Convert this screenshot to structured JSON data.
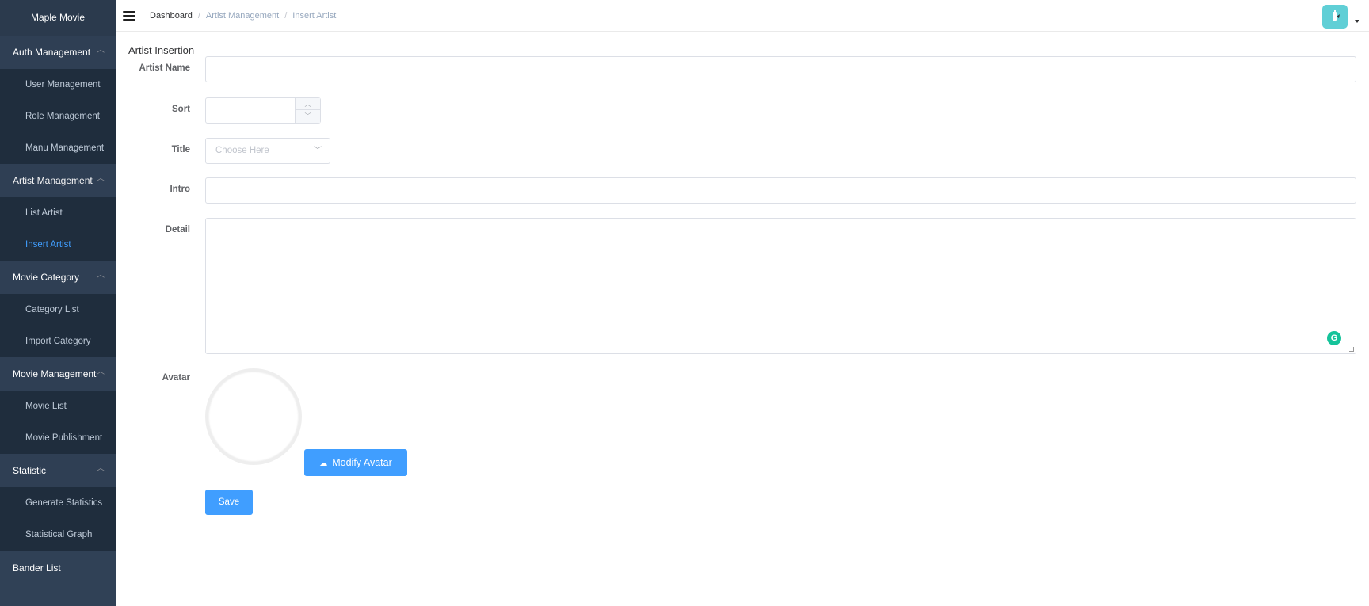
{
  "app": {
    "name": "Maple Movie"
  },
  "sidebar": {
    "groups": [
      {
        "label": "Auth Management",
        "items": [
          "User Management",
          "Role Management",
          "Manu Management"
        ]
      },
      {
        "label": "Artist Management",
        "items": [
          "List Artist",
          "Insert Artist"
        ]
      },
      {
        "label": "Movie Category",
        "items": [
          "Category List",
          "Import Category"
        ]
      },
      {
        "label": "Movie Management",
        "items": [
          "Movie List",
          "Movie Publishment"
        ]
      },
      {
        "label": "Statistic",
        "items": [
          "Generate Statistics",
          "Statistical Graph"
        ]
      }
    ],
    "bottom_item": "Bander List",
    "active_item": "Insert Artist"
  },
  "header": {
    "breadcrumb": [
      "Dashboard",
      "Artist Management",
      "Insert Artist"
    ],
    "breadcrumb_separator": "/"
  },
  "form": {
    "title": "Artist Insertion",
    "fields": {
      "artist_name": {
        "label": "Artist Name",
        "value": ""
      },
      "sort": {
        "label": "Sort",
        "value": ""
      },
      "title": {
        "label": "Title",
        "placeholder": "Choose Here"
      },
      "intro": {
        "label": "Intro",
        "value": ""
      },
      "detail": {
        "label": "Detail",
        "value": ""
      },
      "avatar": {
        "label": "Avatar"
      }
    },
    "modify_avatar_label": "Modify Avatar",
    "save_label": "Save"
  },
  "colors": {
    "sidebar_bg": "#304156",
    "submenu_bg": "#1f2d3d",
    "active_text": "#409eff",
    "primary": "#409eff",
    "avatar_bg": "#60cfd6"
  },
  "icons": {
    "menu": "hamburger-icon",
    "chevron": "chevron-up-icon",
    "upload": "cloud-upload-icon",
    "grammarly": "grammarly-icon"
  }
}
